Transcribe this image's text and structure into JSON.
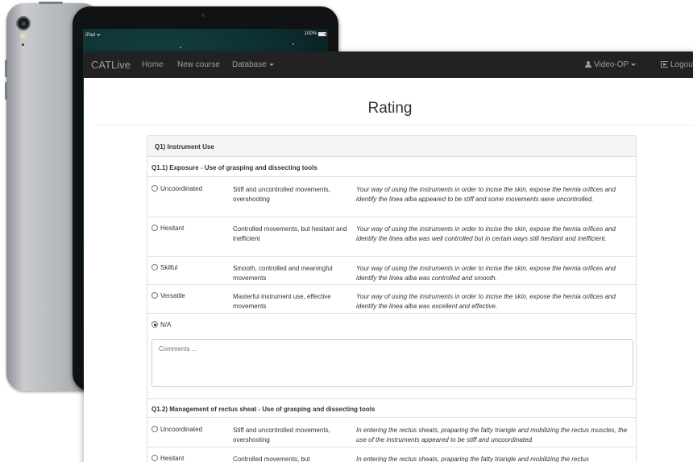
{
  "device": {
    "status_carrier": "iPad ᯤ",
    "status_battery": "100%"
  },
  "navbar": {
    "brand": "CATLive",
    "links": [
      "Home",
      "New course",
      "Database"
    ],
    "user": "Video-OP",
    "logout": "Logout"
  },
  "page": {
    "title": "Rating"
  },
  "panel": {
    "heading": "Q1) Instrument Use",
    "sections": [
      {
        "title": "Q1.1) Exposure - Use of grasping and dissecting tools",
        "options": [
          {
            "label": "Uncoordinated",
            "criteria": "Stiff and uncontrolled movements, overshooting",
            "description": "Your way of using the instruments in order to incise the skin, expose the hernia orifices and identify the linea alba appeared to be stiff and some movements were uncontrolled.",
            "selected": false
          },
          {
            "label": "Hesitant",
            "criteria": "Controlled movements, but hesitant and inefficient",
            "description": "Your way of using the instruments in order to incise the skin, expose the hernia orifices and identify the linea alba was well controlled but in certain ways still hesitant and inefficient.",
            "selected": false
          },
          {
            "label": "Skilful",
            "criteria": "Smooth, controlled and meaningful movements",
            "description": "Your way of using the instruments in order to incise the skin, expose the hernia orifices and identify the linea alba was controlled and smooth.",
            "selected": false
          },
          {
            "label": "Versatile",
            "criteria": "Masterful instrument use, effective movements",
            "description": "Your way of using the instruments in order to incise the skin, expose the hernia orifices and identify the linea alba was excellent and effective.",
            "selected": false
          },
          {
            "label": "N/A",
            "criteria": "",
            "description": "",
            "selected": true
          }
        ],
        "comments_placeholder": "Comments ..."
      },
      {
        "title": "Q1.2) Management of rectus sheat - Use of grasping and dissecting tools",
        "options": [
          {
            "label": "Uncoordinated",
            "criteria": "Stiff and uncontrolled movements, overshooting",
            "description": "In entering the rectus sheats, praparing the fatty triangle and mobilizing the rectus muscles, the use of the instruments appeared to be stiff and uncoordinated.",
            "selected": false
          },
          {
            "label": "Hesitant",
            "criteria": "Controlled movements, but",
            "description": "In entering the rectus sheats, praparing the fatty triangle and mobilizing the rectus",
            "selected": false
          }
        ]
      }
    ]
  }
}
